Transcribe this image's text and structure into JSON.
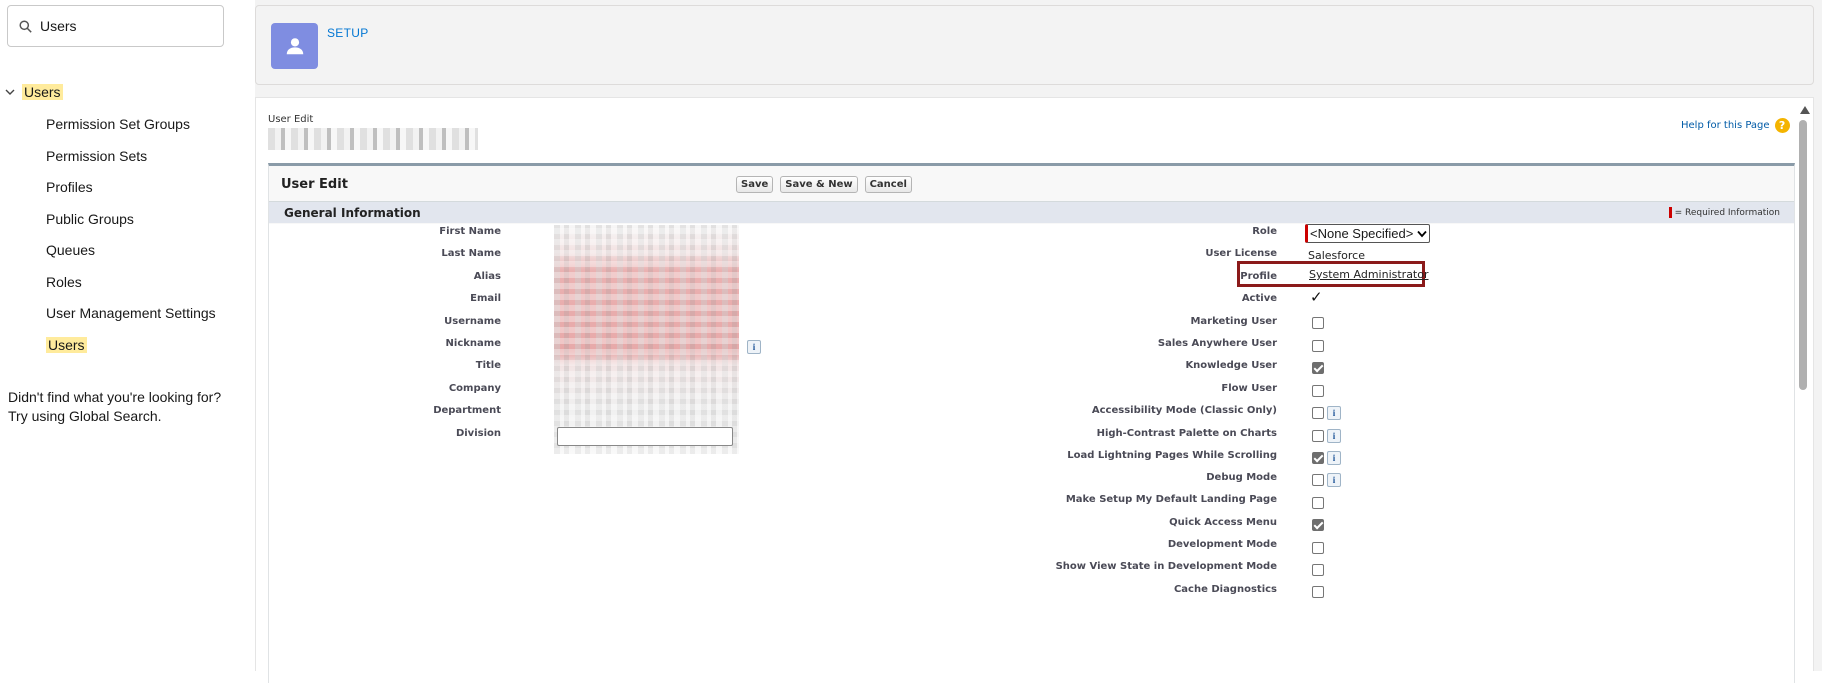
{
  "sidebar": {
    "search_value": "Users",
    "root_label": "Users",
    "items": [
      {
        "label": "Permission Set Groups"
      },
      {
        "label": "Permission Sets"
      },
      {
        "label": "Profiles"
      },
      {
        "label": "Public Groups"
      },
      {
        "label": "Queues"
      },
      {
        "label": "Roles"
      },
      {
        "label": "User Management Settings"
      },
      {
        "label": "Users"
      }
    ],
    "help_line1": "Didn't find what you're looking for?",
    "help_line2": "Try using Global Search."
  },
  "header": {
    "title": "SETUP"
  },
  "page": {
    "type_label": "User Edit",
    "help_link": "Help for this Page",
    "help_icon": "?",
    "edit_title": "User Edit",
    "buttons": {
      "save": "Save",
      "save_new": "Save & New",
      "cancel": "Cancel"
    },
    "section_title": "General Information",
    "required_info": "= Required Information"
  },
  "left_fields": {
    "first_name": "First Name",
    "last_name": "Last Name",
    "alias": "Alias",
    "email": "Email",
    "username": "Username",
    "nickname": "Nickname",
    "title": "Title",
    "company": "Company",
    "department": "Department",
    "division": "Division"
  },
  "right_fields": {
    "role": {
      "label": "Role",
      "value": "<None Specified>"
    },
    "user_license": {
      "label": "User License",
      "value": "Salesforce"
    },
    "profile": {
      "label": "Profile",
      "value": "System Administrator"
    },
    "active": {
      "label": "Active",
      "checked": true
    },
    "marketing_user": {
      "label": "Marketing User",
      "checked": false
    },
    "sales_anywhere_user": {
      "label": "Sales Anywhere User",
      "checked": false
    },
    "knowledge_user": {
      "label": "Knowledge User",
      "checked": true
    },
    "flow_user": {
      "label": "Flow User",
      "checked": false
    },
    "accessibility_mode": {
      "label": "Accessibility Mode (Classic Only)",
      "checked": false
    },
    "high_contrast": {
      "label": "High-Contrast Palette on Charts",
      "checked": false
    },
    "load_lightning": {
      "label": "Load Lightning Pages While Scrolling",
      "checked": true
    },
    "debug_mode": {
      "label": "Debug Mode",
      "checked": false
    },
    "default_landing": {
      "label": "Make Setup My Default Landing Page",
      "checked": false
    },
    "quick_access": {
      "label": "Quick Access Menu",
      "checked": true
    },
    "development_mode": {
      "label": "Development Mode",
      "checked": false
    },
    "view_state": {
      "label": "Show View State in Development Mode",
      "checked": false
    },
    "cache_diagnostics": {
      "label": "Cache Diagnostics",
      "checked": false
    }
  },
  "info_icon": "i",
  "colors": {
    "highlight": "#ffeb9c",
    "avatar": "#7f8de1",
    "link": "#0176d3",
    "profile_box": "#8b1a1a",
    "side_tab": "#1b5f8d"
  }
}
